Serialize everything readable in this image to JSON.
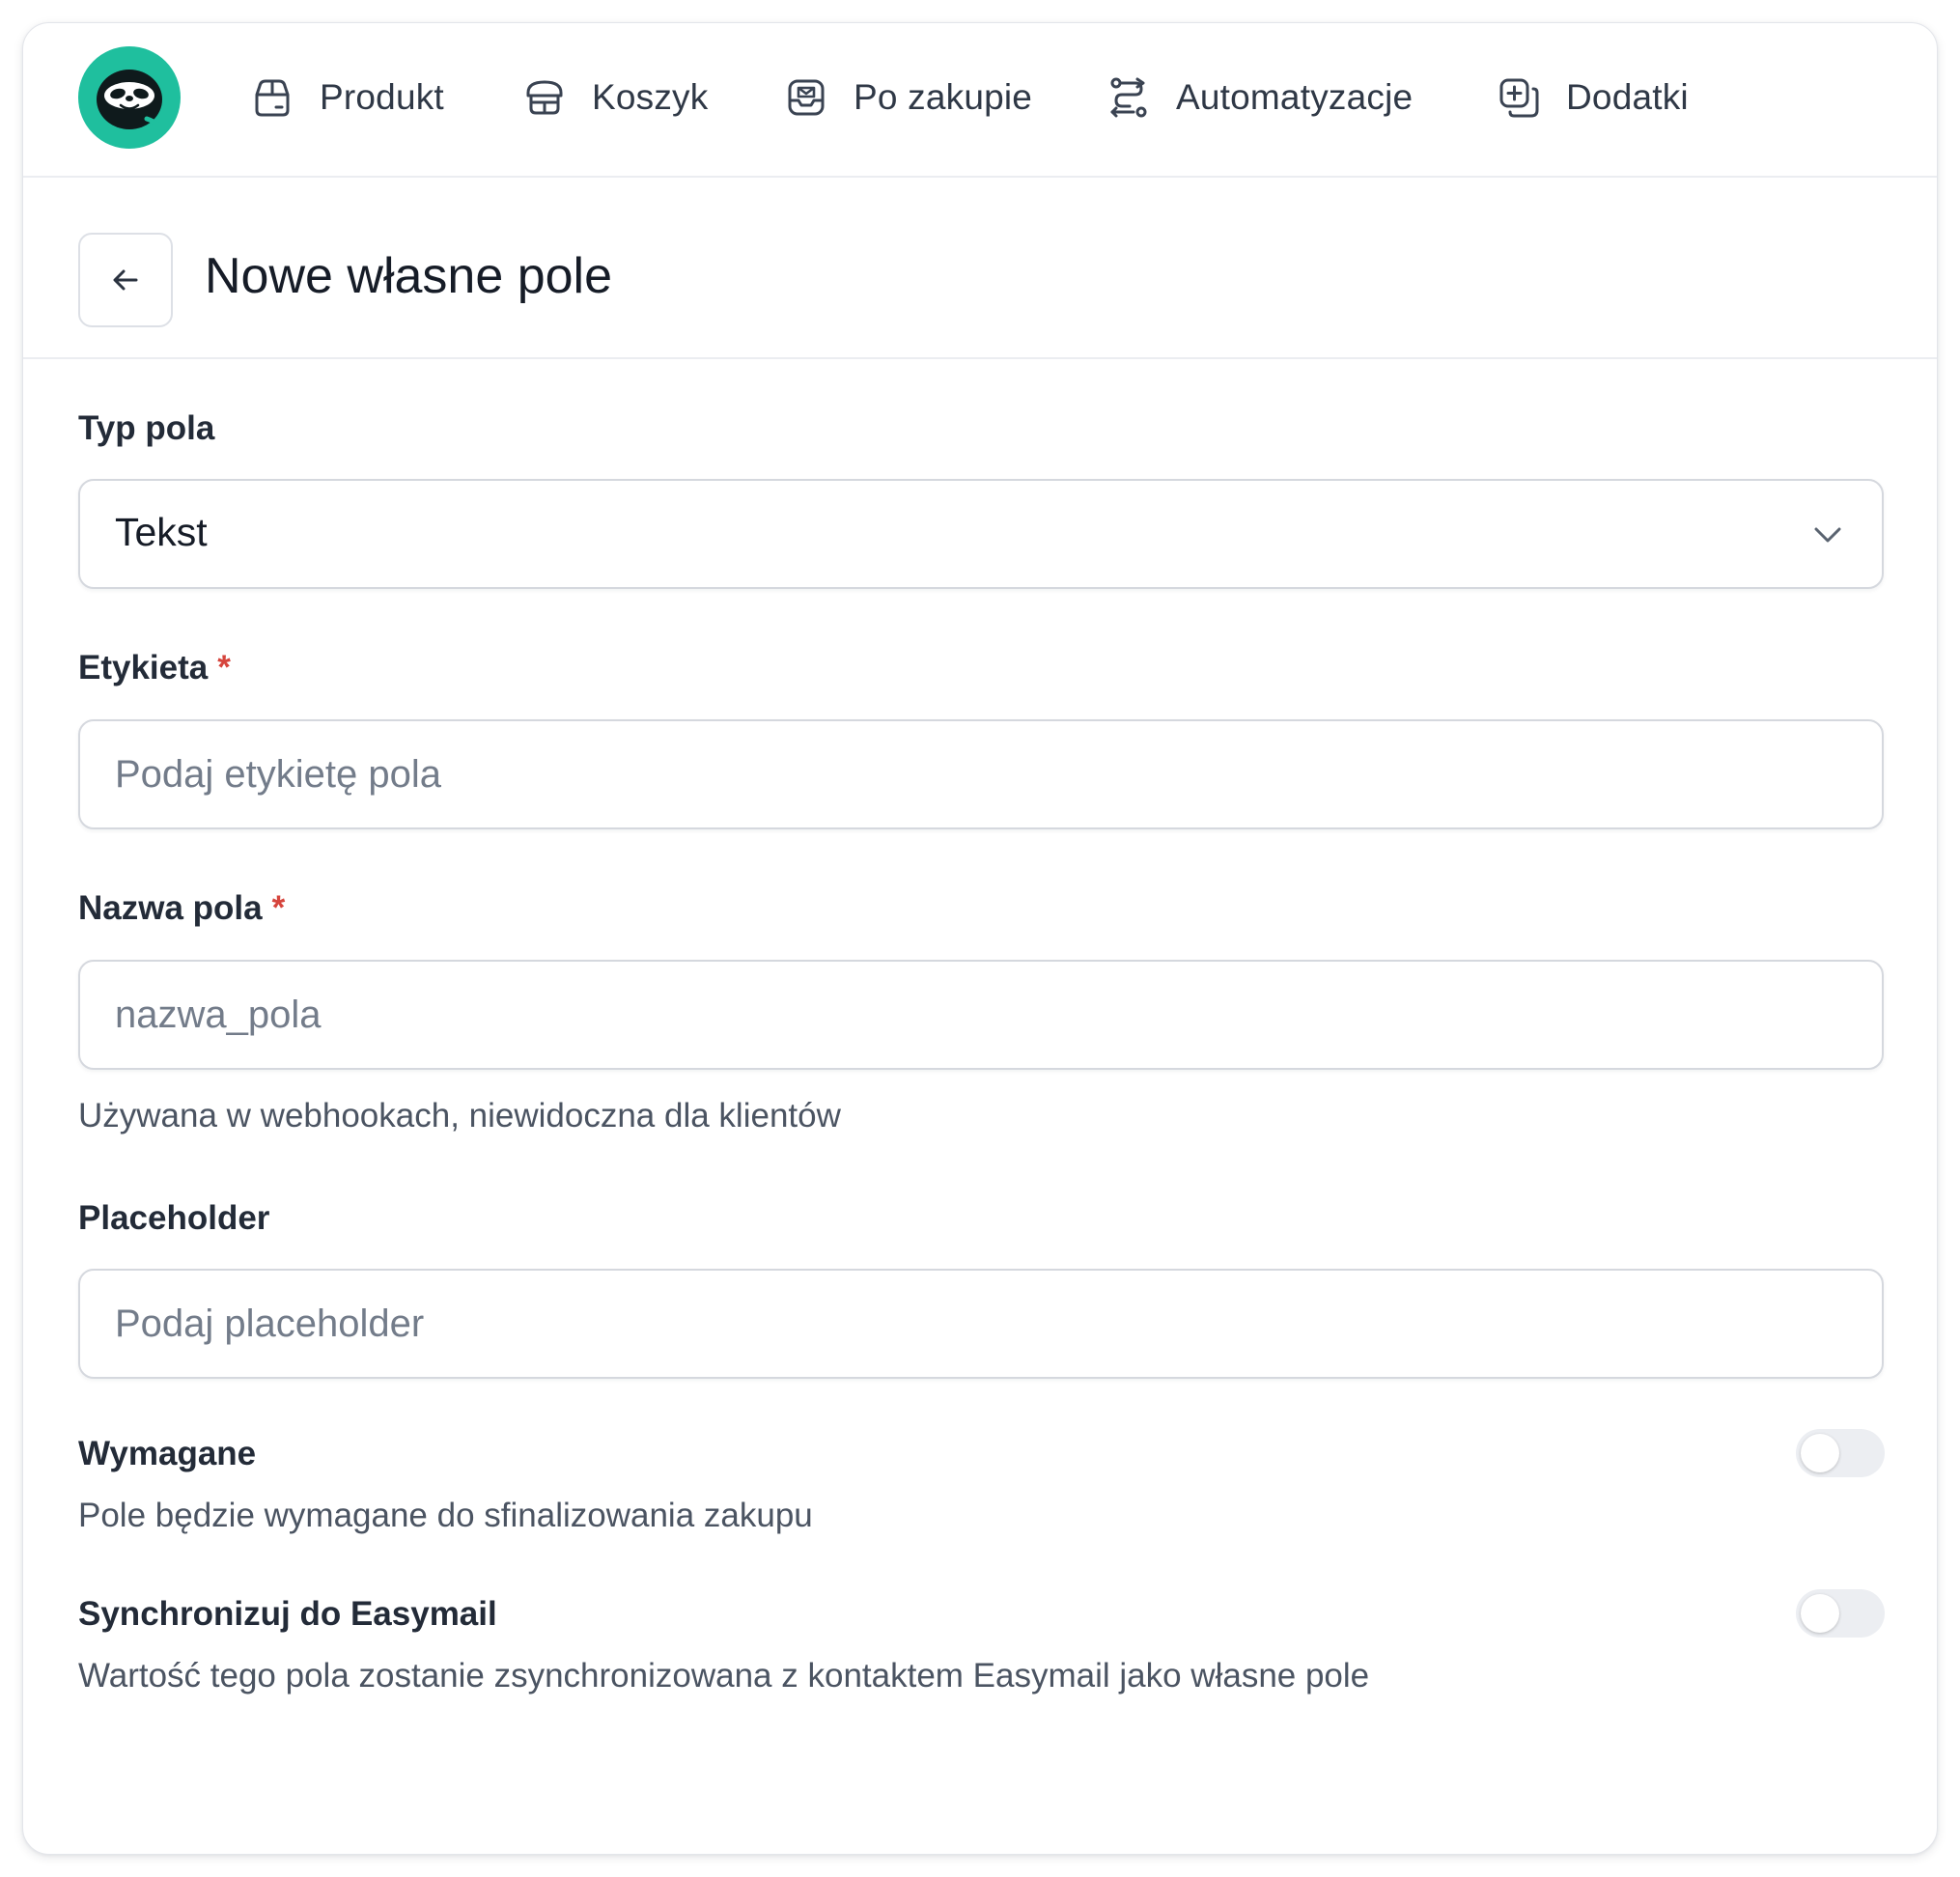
{
  "app": {
    "logo_icon": "sloth-logo-icon",
    "brand_color": "#1fbf9e"
  },
  "nav": {
    "items": [
      {
        "label": "Produkt",
        "icon": "product-box-icon"
      },
      {
        "label": "Koszyk",
        "icon": "cart-icon"
      },
      {
        "label": "Po zakupie",
        "icon": "inbox-mail-icon"
      },
      {
        "label": "Automatyzacje",
        "icon": "route-automation-icon"
      },
      {
        "label": "Dodatki",
        "icon": "add-copy-icon"
      }
    ]
  },
  "header": {
    "back_icon": "arrow-left-icon",
    "title": "Nowe własne pole"
  },
  "form": {
    "field_type": {
      "label": "Typ pola",
      "value": "Tekst",
      "icon": "chevron-down-icon"
    },
    "label_field": {
      "label": "Etykieta",
      "required_mark": "*",
      "value": "",
      "placeholder": "Podaj etykietę pola"
    },
    "name_field": {
      "label": "Nazwa pola",
      "required_mark": "*",
      "value": "",
      "placeholder": "nazwa_pola",
      "help": "Używana w webhookach, niewidoczna dla klientów"
    },
    "placeholder_field": {
      "label": "Placeholder",
      "value": "",
      "placeholder": "Podaj placeholder"
    },
    "required_toggle": {
      "label": "Wymagane",
      "description": "Pole będzie wymagane do sfinalizowania zakupu",
      "on": false
    },
    "sync_toggle": {
      "label": "Synchronizuj do Easymail",
      "description": "Wartość tego pola zostanie zsynchronizowana z kontaktem Easymail jako własne pole",
      "on": false
    }
  },
  "colors": {
    "required": "#d6453d",
    "border": "#d5d8de",
    "toggle_off": "#eceef2"
  }
}
